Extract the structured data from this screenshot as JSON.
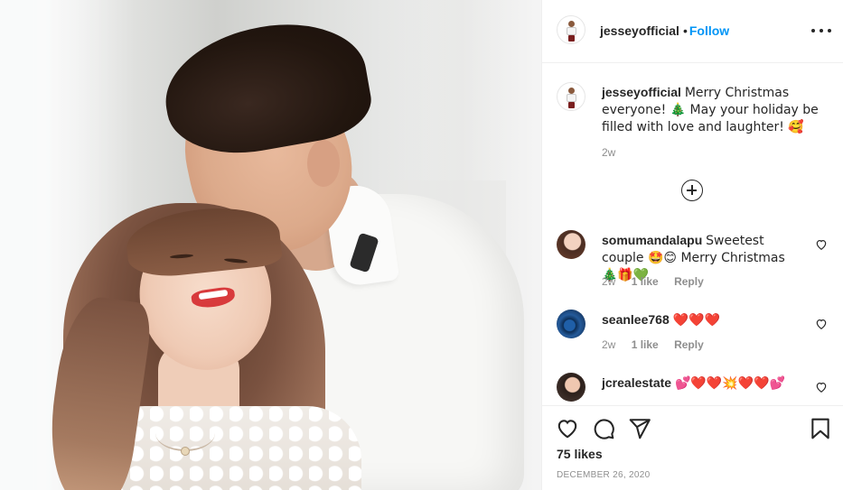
{
  "header": {
    "username": "jesseyofficial",
    "separator": "•",
    "follow_label": "Follow"
  },
  "caption": {
    "username": "jesseyofficial",
    "text": "Merry Christmas everyone! 🎄 May your holiday be filled with love and laughter! 🥰",
    "time": "2w"
  },
  "comments": [
    {
      "username": "somumandalapu",
      "text": "Sweetest couple 🤩😊 Merry Christmas 🎄🎁💚",
      "time": "2w",
      "likes": "1 like",
      "reply_label": "Reply"
    },
    {
      "username": "seanlee768",
      "text": "❤️❤️❤️",
      "time": "2w",
      "likes": "1 like",
      "reply_label": "Reply"
    },
    {
      "username": "jcrealestate",
      "text": "💕❤️❤️💥❤️❤️💕"
    }
  ],
  "footer": {
    "likes": "75 likes",
    "date": "DECEMBER 26, 2020"
  },
  "colors": {
    "link": "#0095f6",
    "text": "#262626",
    "muted": "#8e8e8e",
    "border": "#efefef"
  },
  "icons": [
    "more-icon",
    "plus-circle-icon",
    "heart-icon",
    "comment-icon",
    "share-icon",
    "bookmark-icon"
  ]
}
